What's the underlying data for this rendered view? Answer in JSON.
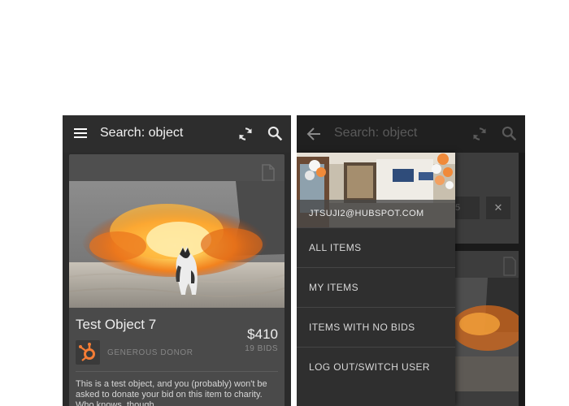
{
  "left_screen": {
    "toolbar": {
      "menu_icon": "hamburger-menu-icon",
      "title": "Search: object",
      "refresh_icon": "refresh-icon",
      "search_icon": "search-icon"
    },
    "item_card": {
      "doc_icon": "document-icon",
      "photo": "explosion-cat-photo",
      "title": "Test Object 7",
      "price": "$410",
      "bids": "19 BIDS",
      "donor_logo": "hubspot-logo",
      "donor_name": "GENEROUS DONOR",
      "description": "This is a test object, and you (probably) won't be asked to donate your bid on this item to charity. Who knows, though."
    }
  },
  "right_screen": {
    "toolbar": {
      "back_icon": "back-arrow-icon",
      "title": "Search: object",
      "refresh_icon": "refresh-icon",
      "search_icon": "search-icon"
    },
    "background": {
      "chip_text": "5",
      "close_label": "✕"
    },
    "drawer": {
      "header_photo": "office-lobby-photo",
      "account_email": "JTSUJI2@HUBSPOT.COM",
      "items": [
        {
          "label": "ALL ITEMS"
        },
        {
          "label": "MY ITEMS"
        },
        {
          "label": "ITEMS WITH NO BIDS"
        },
        {
          "label": "LOG OUT/SWITCH USER"
        }
      ]
    }
  },
  "colors": {
    "toolbar": "#2d2d2d",
    "card": "#4a4a4a",
    "drawer": "#2f2f2f",
    "hubspot_orange": "#f47c35"
  }
}
